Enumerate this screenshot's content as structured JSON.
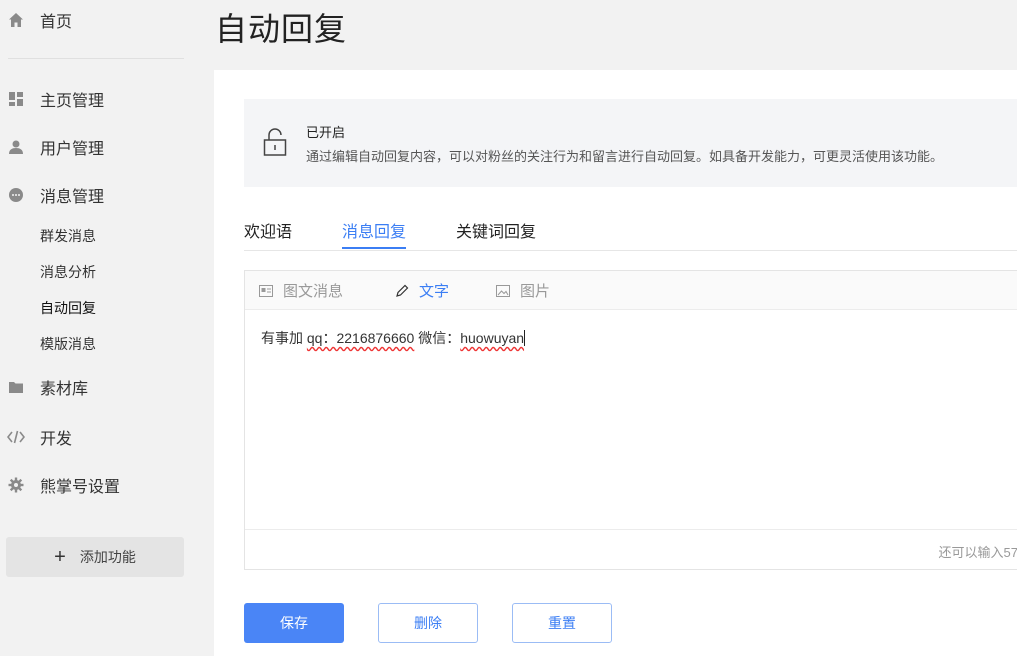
{
  "sidebar": {
    "home": "首页",
    "items": [
      {
        "label": "主页管理",
        "icon": "dashboard-icon"
      },
      {
        "label": "用户管理",
        "icon": "user-icon"
      },
      {
        "label": "消息管理",
        "icon": "chat-icon"
      },
      {
        "label": "素材库",
        "icon": "folder-icon"
      },
      {
        "label": "开发",
        "icon": "code-icon"
      },
      {
        "label": "熊掌号设置",
        "icon": "gear-icon"
      }
    ],
    "sub_items": [
      "群发消息",
      "消息分析",
      "自动回复",
      "模版消息"
    ],
    "active_sub_item": "自动回复",
    "add_button": {
      "plus": "+",
      "label": "添加功能"
    }
  },
  "page": {
    "title": "自动回复"
  },
  "notice": {
    "title": "已开启",
    "description": "通过编辑自动回复内容，可以对粉丝的关注行为和留言进行自动回复。如具备开发能力，可更灵活使用该功能。"
  },
  "tabs": [
    {
      "label": "欢迎语",
      "active": false
    },
    {
      "label": "消息回复",
      "active": true
    },
    {
      "label": "关键词回复",
      "active": false
    }
  ],
  "editor": {
    "toolbar": [
      {
        "label": "图文消息",
        "icon": "article-icon",
        "active": false
      },
      {
        "label": "文字",
        "icon": "pencil-icon",
        "active": true
      },
      {
        "label": "图片",
        "icon": "image-icon",
        "active": false
      }
    ],
    "content": {
      "part1": "有事加 ",
      "part2": "qq：2216876660",
      "part3": " 微信：",
      "part4": "huowuyan"
    },
    "counter": "还可以输入57"
  },
  "buttons": {
    "save": "保存",
    "delete": "删除",
    "reset": "重置"
  },
  "colors": {
    "accent": "#3b7ef4",
    "primary_button": "#4a85f6",
    "sidebar_bg": "#f2f2f2"
  }
}
